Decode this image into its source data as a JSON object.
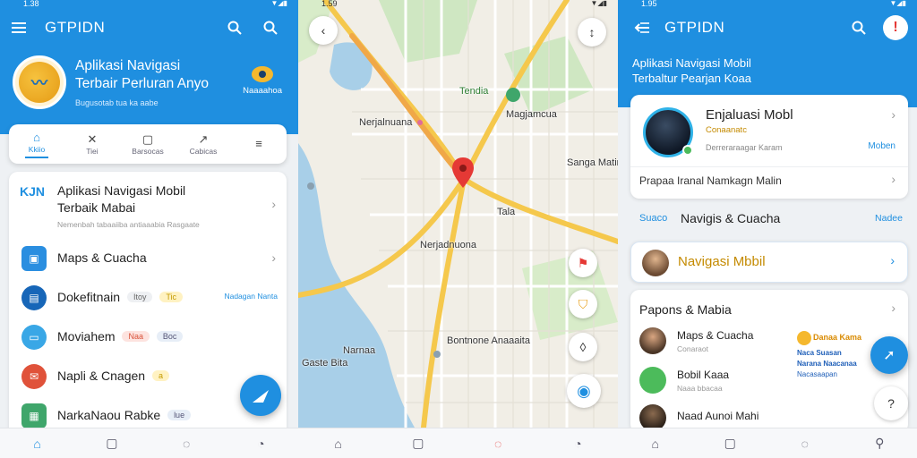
{
  "screen1": {
    "status_time": "1.38",
    "app_title": "GTPIDN",
    "hero": {
      "title_line1": "Aplikasi Navigasi",
      "title_line2": "Terbair Perluran Anyo",
      "subtitle": "Bugusotab tua ka aabe",
      "badge_label": "Naaaahoa"
    },
    "tabs": [
      {
        "icon": "home-icon",
        "label": "Kkiio"
      },
      {
        "icon": "tools-icon",
        "label": "Tiei"
      },
      {
        "icon": "square-icon",
        "label": "Barsocas"
      },
      {
        "icon": "route-icon",
        "label": "Cabicas"
      },
      {
        "icon": "menu-icon",
        "label": ""
      }
    ],
    "feature": {
      "icon_text": "KJN",
      "title_line1": "Aplikasi Navigasi Mobil",
      "title_line2": "Terbaik Mabai",
      "subtitle": "Nemenbah tabaaiiba antiaaabia Rasgaate"
    },
    "rows": [
      {
        "label": "Maps & Cuacha",
        "color": "#2a8ee0",
        "icon": "map-box-icon"
      },
      {
        "label": "Dokefitnain",
        "color": "#1766b8",
        "icon": "document-icon",
        "pill1": "Itoy",
        "pill2": "Tic",
        "side_label": "Nadagan Nanta"
      },
      {
        "label": "Moviahem",
        "color": "#39a7e6",
        "icon": "tv-icon",
        "pill1": "Naa",
        "pill2": "Boc"
      },
      {
        "label": "Napli & Cnagen",
        "color": "#e0523a",
        "icon": "chat-icon",
        "pill1": "a"
      },
      {
        "label": "NarkaNaou Rabke",
        "color": "#3fa66b",
        "icon": "chart-icon",
        "pill1": "lue"
      }
    ],
    "bottom_nav": [
      {
        "icon": "home-icon",
        "label": ""
      },
      {
        "icon": "square-icon",
        "label": ""
      },
      {
        "icon": "location-icon",
        "label": ""
      },
      {
        "icon": "clock-icon",
        "label": ""
      }
    ]
  },
  "screen2": {
    "status_time": "1.59",
    "labels": {
      "place1": "Nerjalnuana",
      "place2": "Tendia",
      "place3": "Magjamcua",
      "place4": "Sanga Matir",
      "place5": "Nerjadnuona",
      "place6": "Narnaa",
      "place7": "Bontnone Anaaaita",
      "place8": "Gaste Bita",
      "place9": "Tala"
    }
  },
  "screen3": {
    "status_time": "1.95",
    "app_title": "GTPIDN",
    "header_line1": "Aplikasi Navigasi Mobil",
    "header_line2": "Terbaltur Pearjan Koaa",
    "profile": {
      "name": "Enjaluasi Mobl",
      "subtitle": "Conaanatc",
      "detail": "Derreraraagar Karam",
      "action": "Moben",
      "link_text": "Prapaa Iranal Namkagn Malin"
    },
    "section_title": "Navigis & Cuacha",
    "section_prefix": "Suaco",
    "section_action": "Nadee",
    "highlight": "Navigasi Mbbil",
    "list_title": "Papons & Mabia",
    "list_items": [
      {
        "title": "Maps & Cuacha",
        "sub": "Conaraot"
      },
      {
        "title": "Bobil Kaaa",
        "sub": "Naaa bbacaa"
      },
      {
        "title": "Naad Aunoi Mahi",
        "sub": ""
      }
    ],
    "promo_lines": [
      "Danaa Kama",
      "Naca Suasan",
      "Narana Naacanaa",
      "Nacasaapan"
    ]
  }
}
